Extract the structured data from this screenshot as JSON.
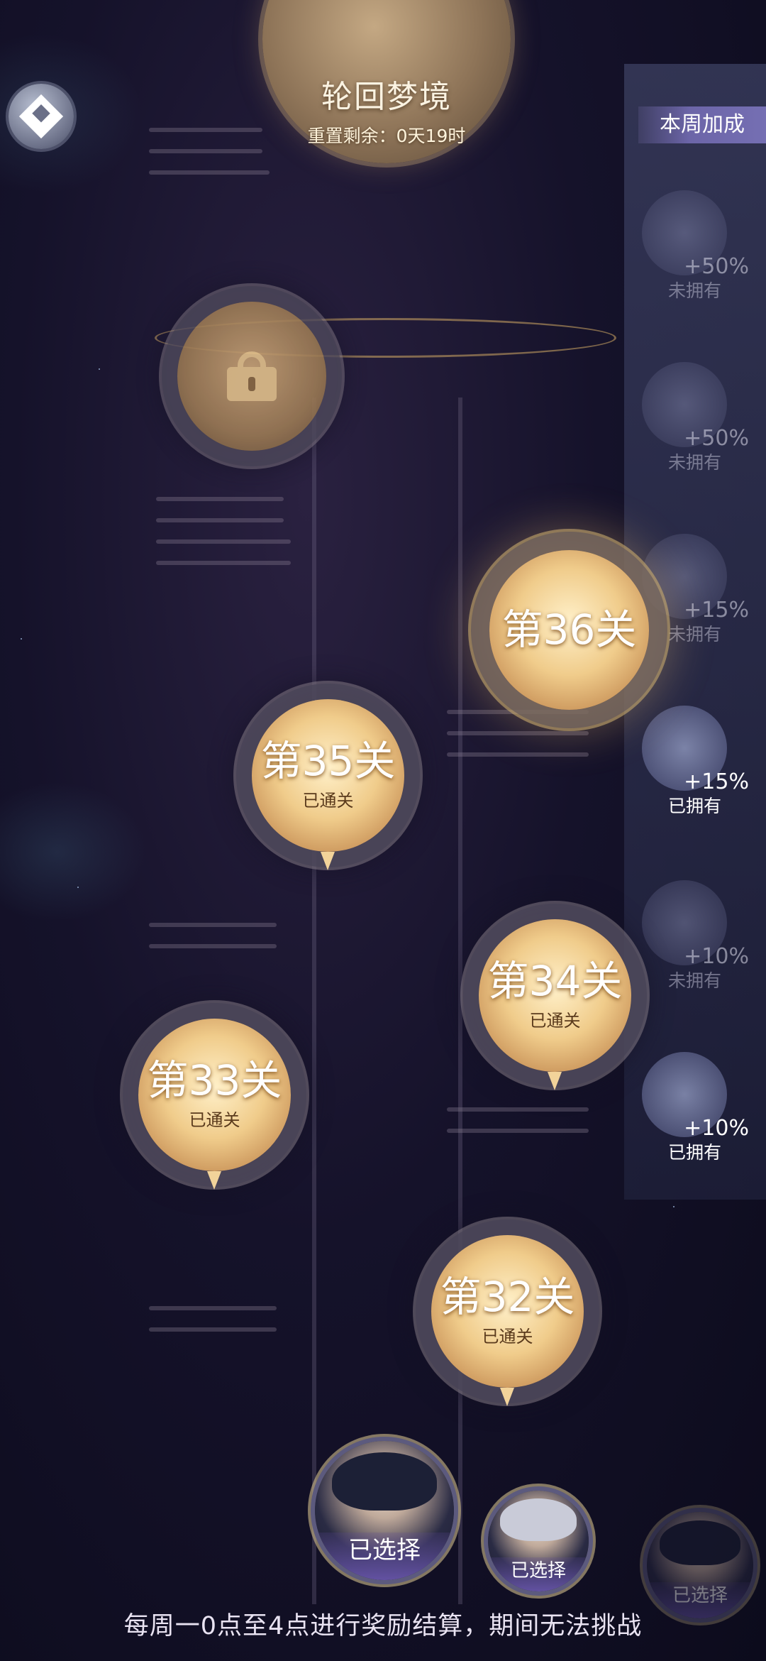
{
  "header": {
    "title": "轮回梦境",
    "reset_text": "重置剩余：0天19时"
  },
  "side_panel": {
    "title": "本周加成",
    "items": [
      {
        "icon": "suit-jacket-icon",
        "bonus": "+50%",
        "status": "未拥有",
        "owned": false
      },
      {
        "icon": "collar-icon",
        "bonus": "+50%",
        "status": "未拥有",
        "owned": false
      },
      {
        "icon": "tuxedo-icon",
        "bonus": "+15%",
        "status": "未拥有",
        "owned": false
      },
      {
        "icon": "glasses-icon",
        "bonus": "+15%",
        "status": "已拥有",
        "owned": true
      },
      {
        "icon": "shirt-icon",
        "bonus": "+10%",
        "status": "未拥有",
        "owned": false
      },
      {
        "icon": "earring-icon",
        "bonus": "+10%",
        "status": "已拥有",
        "owned": true
      }
    ]
  },
  "levels": [
    {
      "label": "第36关",
      "status": "",
      "state": "current"
    },
    {
      "label": "第35关",
      "status": "已通关",
      "state": "cleared"
    },
    {
      "label": "第34关",
      "status": "已通关",
      "state": "cleared"
    },
    {
      "label": "第33关",
      "status": "已通关",
      "state": "cleared"
    },
    {
      "label": "第32关",
      "status": "已通关",
      "state": "cleared"
    }
  ],
  "locked_level": {
    "icon": "lock-icon"
  },
  "characters": [
    {
      "name": "dark-haired-character",
      "selected_label": "已选择"
    },
    {
      "name": "silver-haired-character",
      "selected_label": "已选择"
    },
    {
      "name": "third-character",
      "selected_label": "已选择"
    }
  ],
  "footer": {
    "notice": "每周一0点至4点进行奖励结算，期间无法挑战"
  }
}
